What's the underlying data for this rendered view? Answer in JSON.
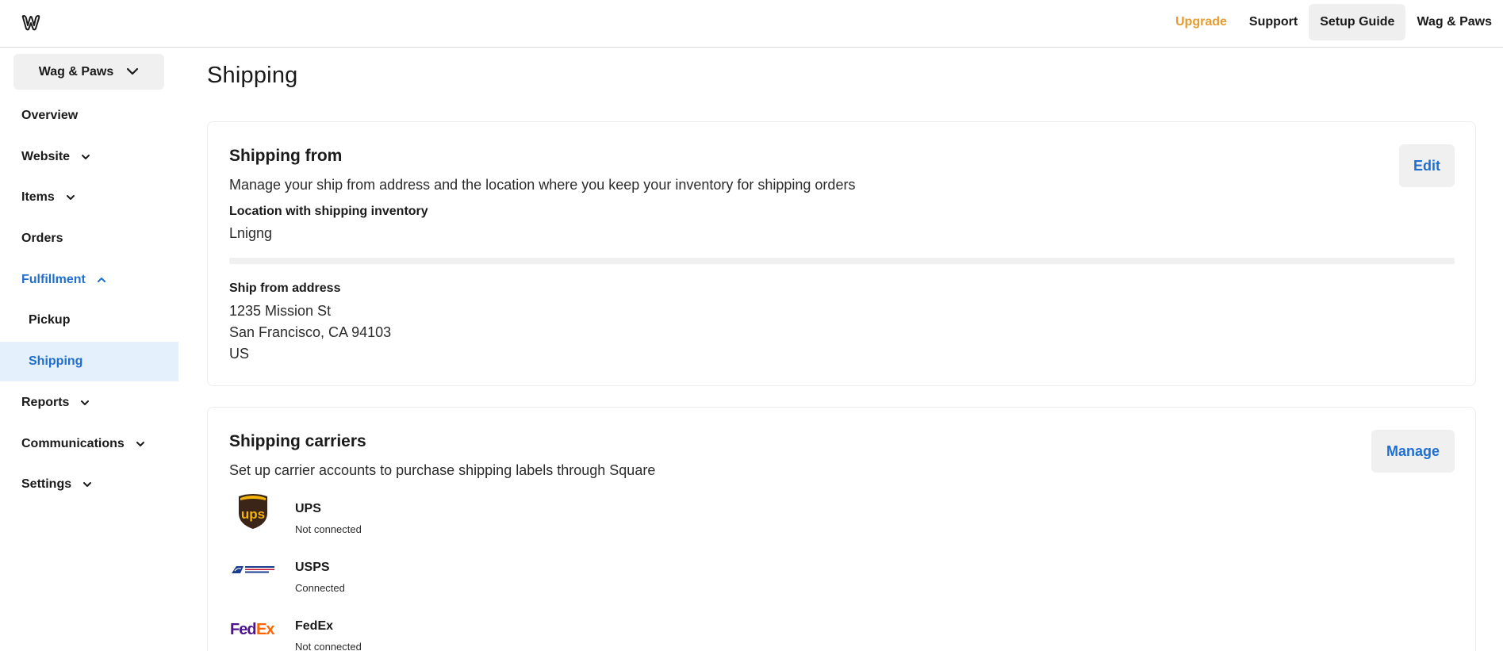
{
  "topbar": {
    "logo_icon": "weebly-w-logo-icon",
    "nav": {
      "upgrade": "Upgrade",
      "support": "Support",
      "setup_guide": "Setup Guide",
      "account": "Wag & Paws"
    },
    "colors": {
      "upgrade": "#e59b32",
      "active_bg": "#efefef"
    }
  },
  "sidebar": {
    "site_switcher": "Wag & Paws",
    "items": [
      {
        "label": "Overview",
        "icon": ""
      },
      {
        "label": "Website",
        "icon": "chevron-down-icon"
      },
      {
        "label": "Items",
        "icon": "chevron-down-icon"
      },
      {
        "label": "Orders",
        "icon": ""
      },
      {
        "label": "Fulfillment",
        "icon": "chevron-up-icon"
      },
      {
        "label": "Pickup",
        "icon": ""
      },
      {
        "label": "Shipping",
        "icon": "",
        "selected": true
      },
      {
        "label": "Reports",
        "icon": "chevron-down-icon"
      },
      {
        "label": "Communications",
        "icon": "chevron-down-icon"
      },
      {
        "label": "Settings",
        "icon": "chevron-down-icon"
      }
    ],
    "colors": {
      "active_text": "#1f6fd0",
      "selected_bg": "#e5f0fd"
    }
  },
  "main": {
    "title": "Shipping",
    "shipping_from": {
      "title": "Shipping from",
      "description": "Manage your ship from address and the location where you keep your inventory for shipping orders",
      "edit_label": "Edit",
      "location_label": "Location with shipping inventory",
      "location_value": "Lnigng",
      "address_label": "Ship from address",
      "address_lines": [
        "1235 Mission St",
        "San Francisco, CA 94103",
        "US"
      ]
    },
    "shipping_carriers": {
      "title": "Shipping carriers",
      "description": "Set up carrier accounts to purchase shipping labels through Square",
      "manage_label": "Manage",
      "carriers": [
        {
          "name": "UPS",
          "status": "Not connected",
          "icon": "ups-logo-icon"
        },
        {
          "name": "USPS",
          "status": "Connected",
          "icon": "usps-logo-icon"
        },
        {
          "name": "FedEx",
          "status": "Not connected",
          "icon": "fedex-logo-icon"
        }
      ]
    }
  },
  "logo_text": {
    "ups": "ups",
    "fedex_fed": "Fed",
    "fedex_ex": "Ex"
  }
}
